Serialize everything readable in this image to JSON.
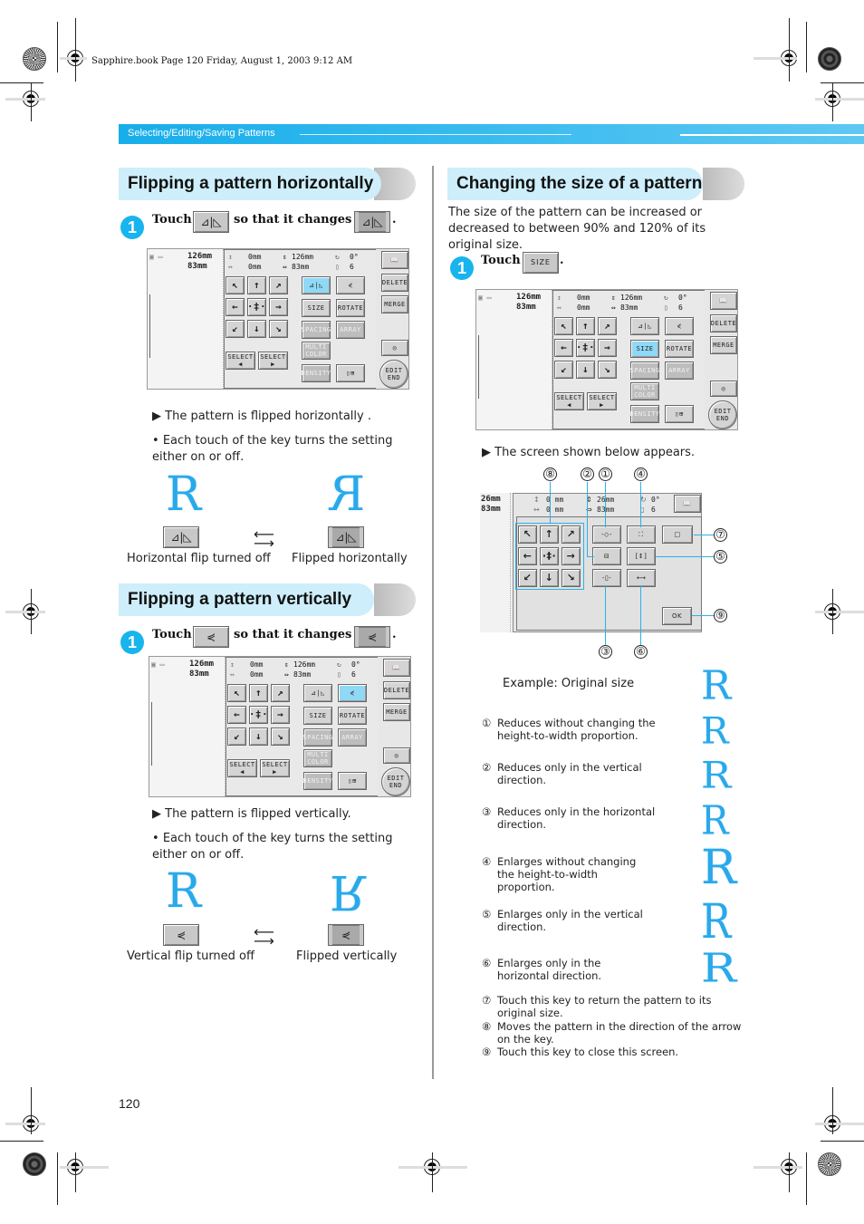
{
  "print_header": "Sapphire.book  Page 120  Friday, August 1, 2003  9:12 AM",
  "band": {
    "label": "Selecting/Editing/Saving Patterns",
    "color": "#17aeea"
  },
  "accent_color": "#18b4ee",
  "page_number": "120",
  "left": {
    "horizontal": {
      "title": "Flipping a pattern horizontally",
      "step_number": "1",
      "touch": "Touch",
      "changes_to": "so that it changes to",
      "key_icon": "mirror-horizontal-icon",
      "key_glyph": "⊿|◺",
      "result": "The pattern is flipped horizontally .",
      "bullet": "Each touch of the key turns the setting either on or off.",
      "caption_off": "Horizontal flip turned off",
      "caption_on": "Flipped horizontally",
      "letter": "R"
    },
    "vertical": {
      "title": "Flipping a pattern vertically",
      "step_number": "1",
      "touch": "Touch",
      "changes_to": "so that it changes to",
      "key_icon": "mirror-vertical-icon",
      "key_glyph": "⋞",
      "result": "The pattern is flipped vertically.",
      "bullet": "Each touch of the key turns the setting either on or off.",
      "caption_off": "Vertical flip turned off",
      "caption_on": "Flipped vertically",
      "letter": "R"
    }
  },
  "lcd": {
    "height": "126mm",
    "width": "83mm",
    "offset_v": "0mm",
    "offset_h": "0mm",
    "size_h": "126mm",
    "size_w": "83mm",
    "rotation": "0°",
    "colors": "6",
    "buttons": {
      "size": "SIZE",
      "rotate": "ROTATE",
      "spacing": "SPACING",
      "array": "ARRAY",
      "multi_color": "MULTI COLOR",
      "density": "DENSITY",
      "select_prev": "SELECT ◀",
      "select_next": "SELECT ▶",
      "delete": "DELETE",
      "merge": "MERGE",
      "edit_end": "EDIT END"
    },
    "arrows": [
      "↖",
      "↑",
      "↗",
      "←",
      "·‡·",
      "→",
      "↙",
      "↓",
      "↘"
    ]
  },
  "right": {
    "title": "Changing the size of a pattern",
    "intro": "The size of the pattern can be increased or decreased to between 90% and 120% of its original size.",
    "step_number": "1",
    "touch": "Touch",
    "size_key": "SIZE",
    "result": "The screen shown below appears.",
    "size_screen": {
      "height": "26mm",
      "width": "83mm",
      "offset_v": "0 mm",
      "offset_h": "0 mm",
      "size_h": "26mm",
      "size_w": "83mm",
      "rotation": "0°",
      "colors": "6",
      "ok": "OK"
    },
    "callouts": [
      "①",
      "②",
      "③",
      "④",
      "⑤",
      "⑥",
      "⑦",
      "⑧",
      "⑨"
    ],
    "example_label": "Example: Original size",
    "legend": [
      {
        "n": "①",
        "text": "Reduces without changing the height-to-width proportion."
      },
      {
        "n": "②",
        "text": "Reduces only in the vertical direction."
      },
      {
        "n": "③",
        "text": "Reduces only in the horizontal direction."
      },
      {
        "n": "④",
        "text": "Enlarges without changing the height-to-width proportion."
      },
      {
        "n": "⑤",
        "text": "Enlarges only in the vertical direction."
      },
      {
        "n": "⑥",
        "text": "Enlarges only in the horizontal direction."
      },
      {
        "n": "⑦",
        "text": "Touch this key to return the pattern to its original size."
      },
      {
        "n": "⑧",
        "text": "Moves the pattern in the direction of the arrow on the key."
      },
      {
        "n": "⑨",
        "text": "Touch this key to close this screen."
      }
    ]
  }
}
